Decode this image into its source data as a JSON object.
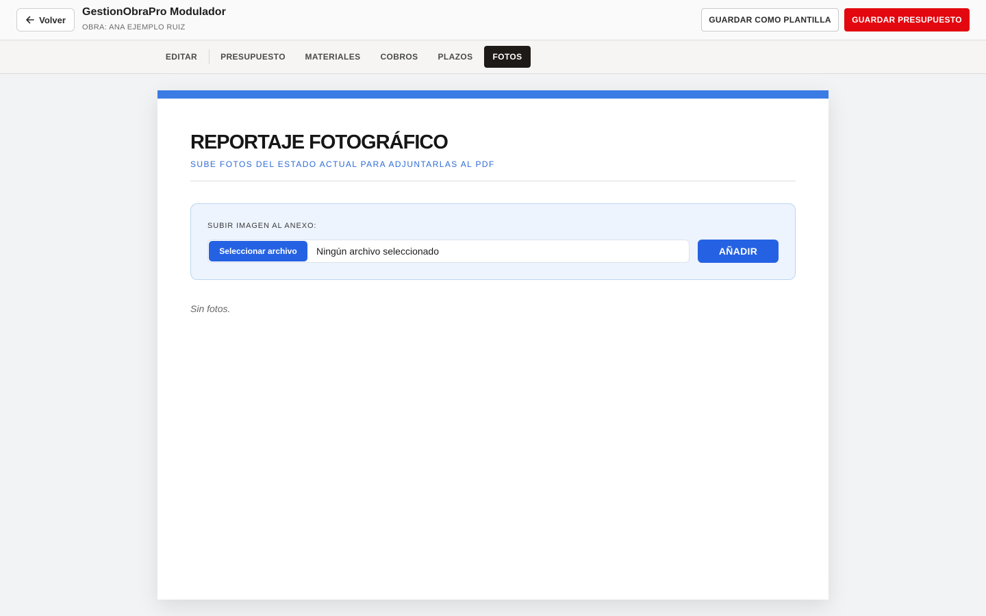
{
  "header": {
    "back_label": "Volver",
    "back_icon": "arrow-left-icon",
    "title": "GestionObraPro Modulador",
    "project": "OBRA: ANA EJEMPLO RUIZ",
    "save_template_label": "GUARDAR COMO PLANTILLA",
    "save_budget_label": "GUARDAR PRESUPUESTO",
    "save_budget_color": "#e3070f"
  },
  "tabs": [
    {
      "label": "EDITAR",
      "active": false
    },
    {
      "label": "PRESUPUESTO",
      "active": false
    },
    {
      "label": "MATERIALES",
      "active": false
    },
    {
      "label": "COBROS",
      "active": false
    },
    {
      "label": "PLAZOS",
      "active": false
    },
    {
      "label": "FOTOS",
      "active": true
    }
  ],
  "card": {
    "accent_color": "#3a7be4",
    "title": "REPORTAJE FOTOGRÁFICO",
    "subtitle": "SUBE FOTOS DEL ESTADO ACTUAL PARA ADJUNTARLAS AL PDF",
    "upload": {
      "label": "SUBIR IMAGEN AL ANEXO:",
      "choose_file_label": "Seleccionar archivo",
      "file_status": "Ningún archivo seleccionado",
      "add_label": "AÑADIR"
    },
    "empty_message": "Sin fotos."
  }
}
